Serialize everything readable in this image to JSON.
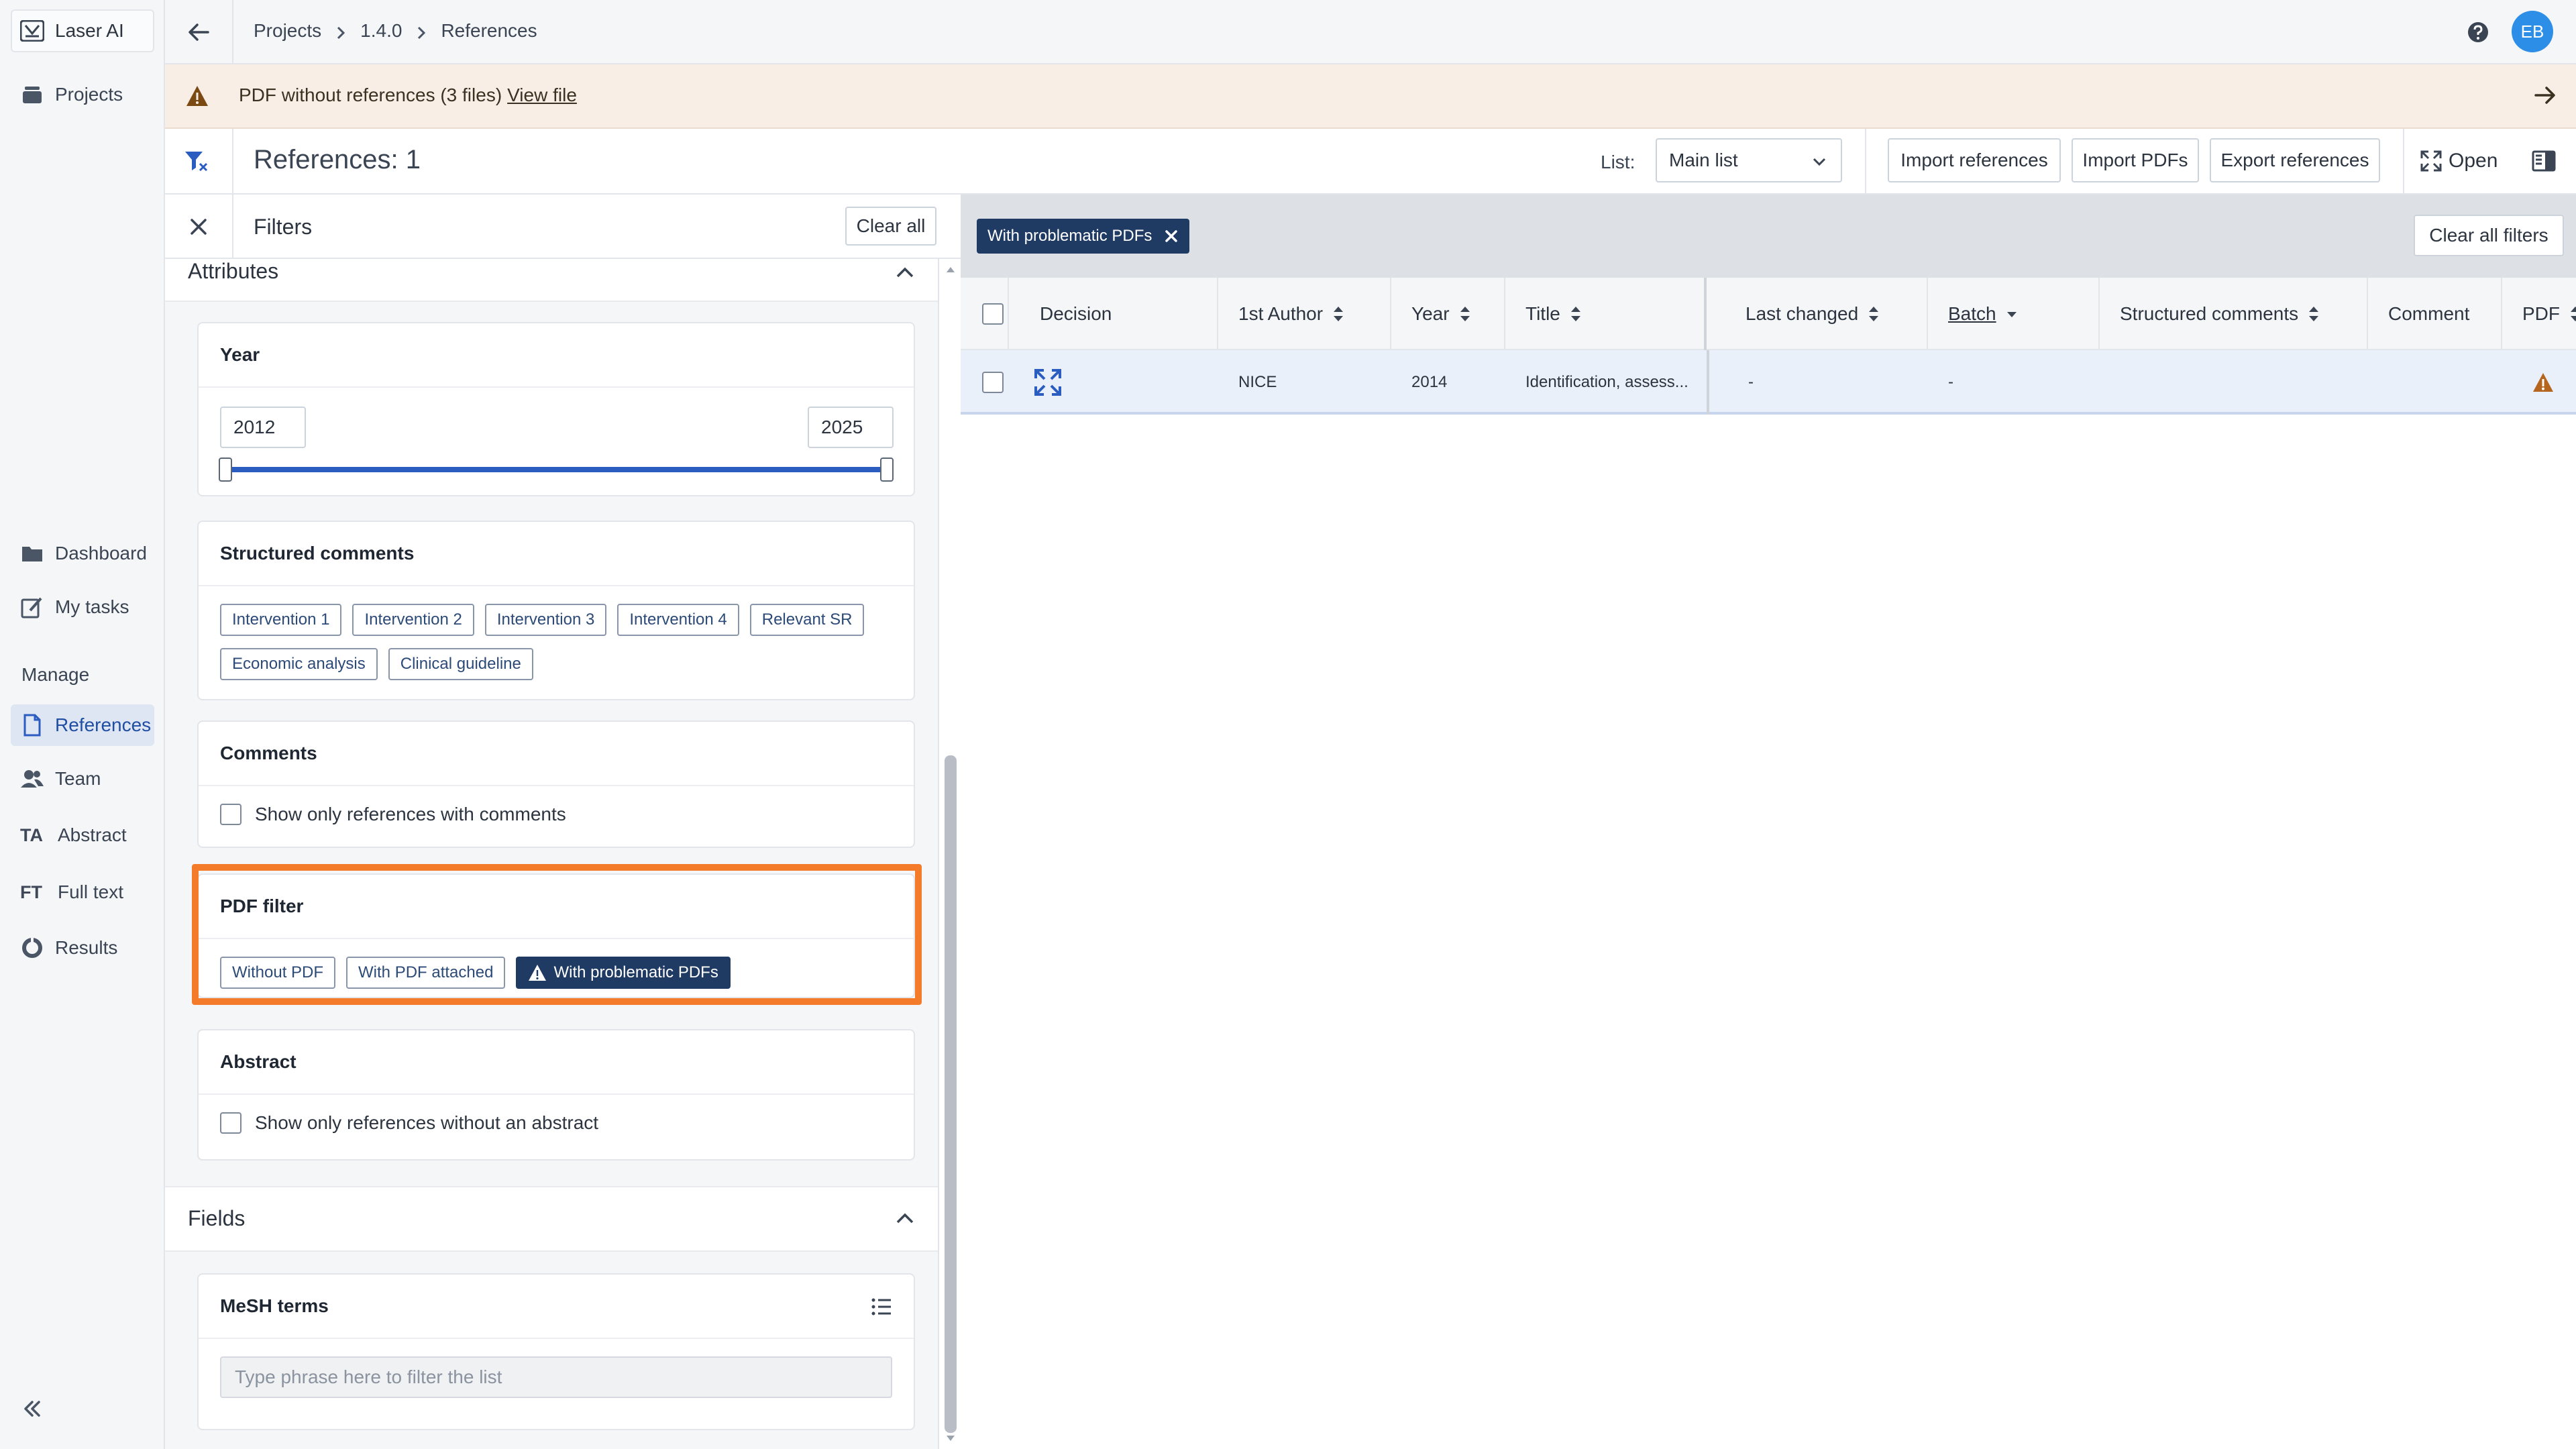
{
  "sidebar": {
    "logo_label": "Laser AI",
    "projects_label": "Projects",
    "dashboard_label": "Dashboard",
    "my_tasks_label": "My tasks",
    "manage_label": "Manage",
    "references_label": "References",
    "team_label": "Team",
    "abstract_letters": "TA",
    "abstract_label": "Abstract",
    "fulltext_letters": "FT",
    "fulltext_label": "Full text",
    "results_label": "Results"
  },
  "topbar": {
    "breadcrumb": [
      "Projects",
      "1.4.0",
      "References"
    ],
    "avatar_initials": "EB"
  },
  "banner": {
    "text": "PDF without references (3 files)",
    "link": "View file"
  },
  "toolbar": {
    "ref_count": "References: 1",
    "list_label": "List:",
    "list_value": "Main list",
    "import_references": "Import references",
    "import_pdfs": "Import PDFs",
    "export_references": "Export references",
    "open_label": "Open"
  },
  "filters": {
    "title": "Filters",
    "clear_all": "Clear all",
    "attributes_label": "Attributes",
    "year": {
      "title": "Year",
      "min": "2012",
      "max": "2025"
    },
    "structured_comments": {
      "title": "Structured comments",
      "tags": [
        "Intervention 1",
        "Intervention 2",
        "Intervention 3",
        "Intervention 4",
        "Relevant SR",
        "Economic analysis",
        "Clinical guideline"
      ]
    },
    "comments": {
      "title": "Comments",
      "checkbox_label": "Show only references with comments"
    },
    "pdf_filter": {
      "title": "PDF filter",
      "options": [
        "Without PDF",
        "With PDF attached",
        "With problematic PDFs"
      ],
      "selected": "With problematic PDFs"
    },
    "abstract": {
      "title": "Abstract",
      "checkbox_label": "Show only references without an abstract"
    },
    "fields_label": "Fields",
    "mesh": {
      "title": "MeSH terms",
      "placeholder": "Type phrase here to filter the list"
    }
  },
  "main": {
    "active_chip": "With problematic PDFs",
    "clear_all_filters": "Clear all filters",
    "columns": [
      "Decision",
      "1st Author",
      "Year",
      "Title",
      "Last changed",
      "Batch",
      "Structured comments",
      "Comment",
      "PDF"
    ],
    "rows": [
      {
        "author": "NICE",
        "year": "2014",
        "title": "Identification, assess...",
        "last_changed": "-",
        "batch": "-",
        "structured_comments": "",
        "comment": "",
        "pdf_status": "warning-icon"
      }
    ]
  },
  "colors": {
    "accent": "#2b5cc0",
    "selected_tag": "#1f3a63",
    "highlight": "#f47b2a",
    "warning": "#b5651d",
    "banner_bg": "#f9eee6"
  }
}
